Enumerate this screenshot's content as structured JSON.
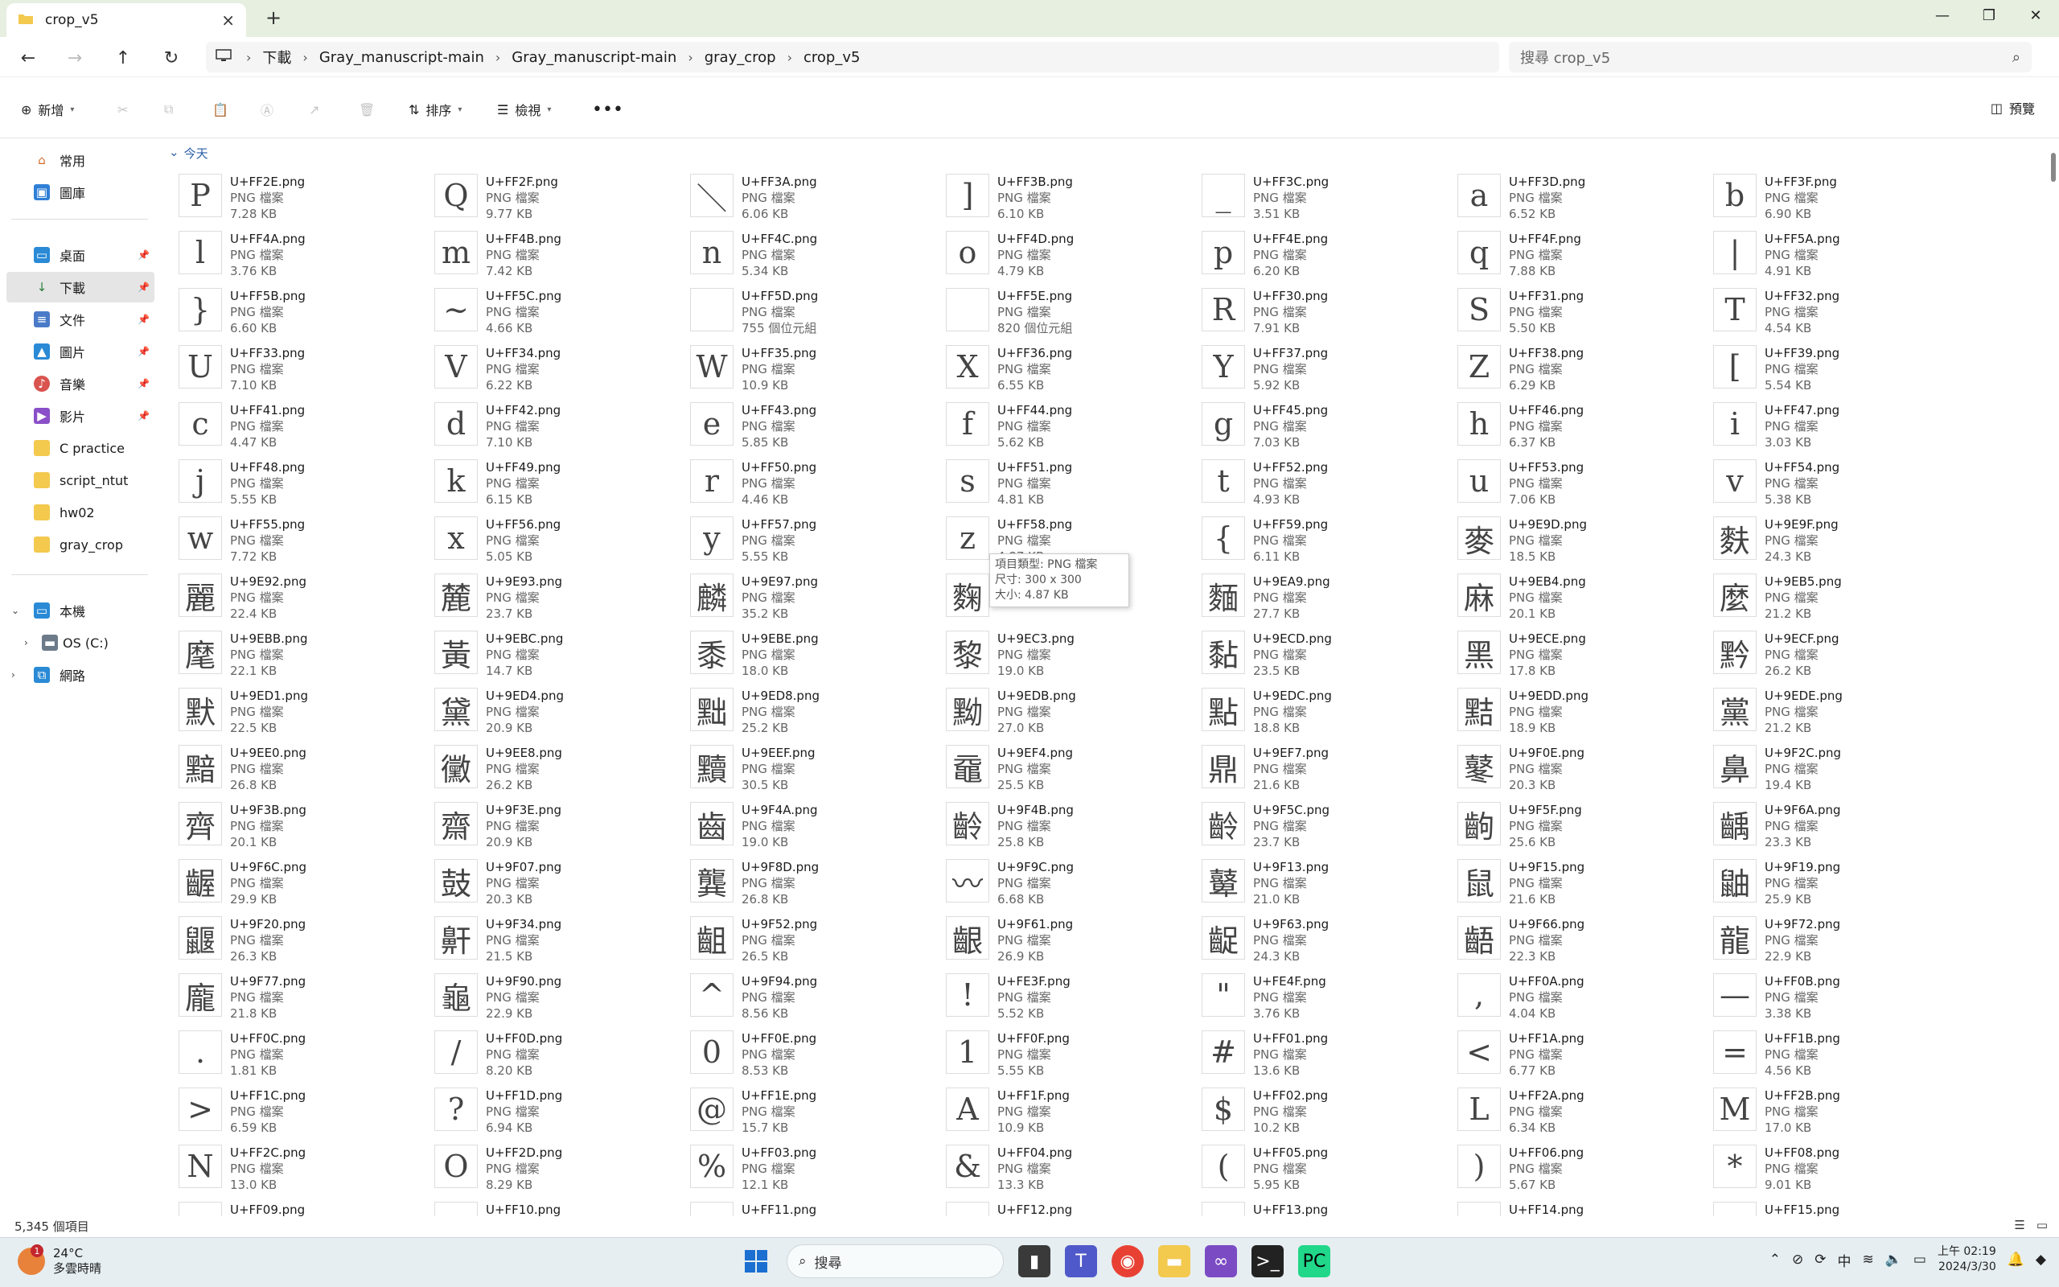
{
  "window": {
    "tab_title": "crop_v5"
  },
  "breadcrumb": [
    "下載",
    "Gray_manuscript-main",
    "Gray_manuscript-main",
    "gray_crop",
    "crop_v5"
  ],
  "search": {
    "placeholder": "搜尋 crop_v5"
  },
  "toolbar": {
    "new": "新增",
    "sort": "排序",
    "view": "檢視",
    "preview": "預覽"
  },
  "sidebar": {
    "home": "常用",
    "gallery": "圖庫",
    "pinned": [
      {
        "label": "桌面",
        "icon": "desktop-icon"
      },
      {
        "label": "下載",
        "icon": "download-icon"
      },
      {
        "label": "文件",
        "icon": "document-icon"
      },
      {
        "label": "圖片",
        "icon": "picture-icon"
      },
      {
        "label": "音樂",
        "icon": "music-icon"
      },
      {
        "label": "影片",
        "icon": "video-icon"
      }
    ],
    "folders": [
      "C practice",
      "script_ntut",
      "hw02",
      "gray_crop"
    ],
    "this_pc": "本機",
    "os_drive": "OS (C:)",
    "network": "網路"
  },
  "group_header": "今天",
  "files": [
    {
      "name": "U+FF2E.png",
      "type": "PNG 檔案",
      "size": "7.28 KB",
      "glyph": "P"
    },
    {
      "name": "U+FF2F.png",
      "type": "PNG 檔案",
      "size": "9.77 KB",
      "glyph": "Q"
    },
    {
      "name": "U+FF3A.png",
      "type": "PNG 檔案",
      "size": "6.06 KB",
      "glyph": "＼"
    },
    {
      "name": "U+FF3B.png",
      "type": "PNG 檔案",
      "size": "6.10 KB",
      "glyph": "]"
    },
    {
      "name": "U+FF3C.png",
      "type": "PNG 檔案",
      "size": "3.51 KB",
      "glyph": "_"
    },
    {
      "name": "U+FF3D.png",
      "type": "PNG 檔案",
      "size": "6.52 KB",
      "glyph": "a"
    },
    {
      "name": "U+FF3F.png",
      "type": "PNG 檔案",
      "size": "6.90 KB",
      "glyph": "b"
    },
    {
      "name": "U+FF4A.png",
      "type": "PNG 檔案",
      "size": "3.76 KB",
      "glyph": "l"
    },
    {
      "name": "U+FF4B.png",
      "type": "PNG 檔案",
      "size": "7.42 KB",
      "glyph": "m"
    },
    {
      "name": "U+FF4C.png",
      "type": "PNG 檔案",
      "size": "5.34 KB",
      "glyph": "n"
    },
    {
      "name": "U+FF4D.png",
      "type": "PNG 檔案",
      "size": "4.79 KB",
      "glyph": "o"
    },
    {
      "name": "U+FF4E.png",
      "type": "PNG 檔案",
      "size": "6.20 KB",
      "glyph": "p"
    },
    {
      "name": "U+FF4F.png",
      "type": "PNG 檔案",
      "size": "7.88 KB",
      "glyph": "q"
    },
    {
      "name": "U+FF5A.png",
      "type": "PNG 檔案",
      "size": "4.91 KB",
      "glyph": "|"
    },
    {
      "name": "U+FF5B.png",
      "type": "PNG 檔案",
      "size": "6.60 KB",
      "glyph": "}"
    },
    {
      "name": "U+FF5C.png",
      "type": "PNG 檔案",
      "size": "4.66 KB",
      "glyph": "~"
    },
    {
      "name": "U+FF5D.png",
      "type": "PNG 檔案",
      "size": "755 個位元組",
      "glyph": ""
    },
    {
      "name": "U+FF5E.png",
      "type": "PNG 檔案",
      "size": "820 個位元組",
      "glyph": ""
    },
    {
      "name": "U+FF30.png",
      "type": "PNG 檔案",
      "size": "7.91 KB",
      "glyph": "R"
    },
    {
      "name": "U+FF31.png",
      "type": "PNG 檔案",
      "size": "5.50 KB",
      "glyph": "S"
    },
    {
      "name": "U+FF32.png",
      "type": "PNG 檔案",
      "size": "4.54 KB",
      "glyph": "T"
    },
    {
      "name": "U+FF33.png",
      "type": "PNG 檔案",
      "size": "7.10 KB",
      "glyph": "U"
    },
    {
      "name": "U+FF34.png",
      "type": "PNG 檔案",
      "size": "6.22 KB",
      "glyph": "V"
    },
    {
      "name": "U+FF35.png",
      "type": "PNG 檔案",
      "size": "10.9 KB",
      "glyph": "W"
    },
    {
      "name": "U+FF36.png",
      "type": "PNG 檔案",
      "size": "6.55 KB",
      "glyph": "X"
    },
    {
      "name": "U+FF37.png",
      "type": "PNG 檔案",
      "size": "5.92 KB",
      "glyph": "Y"
    },
    {
      "name": "U+FF38.png",
      "type": "PNG 檔案",
      "size": "6.29 KB",
      "glyph": "Z"
    },
    {
      "name": "U+FF39.png",
      "type": "PNG 檔案",
      "size": "5.54 KB",
      "glyph": "["
    },
    {
      "name": "U+FF41.png",
      "type": "PNG 檔案",
      "size": "4.47 KB",
      "glyph": "c"
    },
    {
      "name": "U+FF42.png",
      "type": "PNG 檔案",
      "size": "7.10 KB",
      "glyph": "d"
    },
    {
      "name": "U+FF43.png",
      "type": "PNG 檔案",
      "size": "5.85 KB",
      "glyph": "e"
    },
    {
      "name": "U+FF44.png",
      "type": "PNG 檔案",
      "size": "5.62 KB",
      "glyph": "f"
    },
    {
      "name": "U+FF45.png",
      "type": "PNG 檔案",
      "size": "7.03 KB",
      "glyph": "g"
    },
    {
      "name": "U+FF46.png",
      "type": "PNG 檔案",
      "size": "6.37 KB",
      "glyph": "h"
    },
    {
      "name": "U+FF47.png",
      "type": "PNG 檔案",
      "size": "3.03 KB",
      "glyph": "i"
    },
    {
      "name": "U+FF48.png",
      "type": "PNG 檔案",
      "size": "5.55 KB",
      "glyph": "j"
    },
    {
      "name": "U+FF49.png",
      "type": "PNG 檔案",
      "size": "6.15 KB",
      "glyph": "k"
    },
    {
      "name": "U+FF50.png",
      "type": "PNG 檔案",
      "size": "4.46 KB",
      "glyph": "r"
    },
    {
      "name": "U+FF51.png",
      "type": "PNG 檔案",
      "size": "4.81 KB",
      "glyph": "s"
    },
    {
      "name": "U+FF52.png",
      "type": "PNG 檔案",
      "size": "4.93 KB",
      "glyph": "t"
    },
    {
      "name": "U+FF53.png",
      "type": "PNG 檔案",
      "size": "7.06 KB",
      "glyph": "u"
    },
    {
      "name": "U+FF54.png",
      "type": "PNG 檔案",
      "size": "5.38 KB",
      "glyph": "v"
    },
    {
      "name": "U+FF55.png",
      "type": "PNG 檔案",
      "size": "7.72 KB",
      "glyph": "w"
    },
    {
      "name": "U+FF56.png",
      "type": "PNG 檔案",
      "size": "5.05 KB",
      "glyph": "x"
    },
    {
      "name": "U+FF57.png",
      "type": "PNG 檔案",
      "size": "5.55 KB",
      "glyph": "y"
    },
    {
      "name": "U+FF58.png",
      "type": "PNG 檔案",
      "size": "4.87 KB",
      "glyph": "z"
    },
    {
      "name": "U+FF59.png",
      "type": "PNG 檔案",
      "size": "6.11 KB",
      "glyph": "{"
    },
    {
      "name": "U+9E9D.png",
      "type": "PNG 檔案",
      "size": "18.5 KB",
      "glyph": "麥"
    },
    {
      "name": "U+9E9F.png",
      "type": "PNG 檔案",
      "size": "24.3 KB",
      "glyph": "麩"
    },
    {
      "name": "U+9E92.png",
      "type": "PNG 檔案",
      "size": "22.4 KB",
      "glyph": "麗"
    },
    {
      "name": "U+9E93.png",
      "type": "PNG 檔案",
      "size": "23.7 KB",
      "glyph": "麓"
    },
    {
      "name": "U+9E97.png",
      "type": "PNG 檔案",
      "size": "35.2 KB",
      "glyph": "麟"
    },
    {
      "name": "",
      "type": "",
      "size": "25.6 KB",
      "glyph": "麴"
    },
    {
      "name": "U+9EA9.png",
      "type": "PNG 檔案",
      "size": "27.7 KB",
      "glyph": "麵"
    },
    {
      "name": "U+9EB4.png",
      "type": "PNG 檔案",
      "size": "20.1 KB",
      "glyph": "麻"
    },
    {
      "name": "U+9EB5.png",
      "type": "PNG 檔案",
      "size": "21.2 KB",
      "glyph": "麼"
    },
    {
      "name": "U+9EBB.png",
      "type": "PNG 檔案",
      "size": "22.1 KB",
      "glyph": "麾"
    },
    {
      "name": "U+9EBC.png",
      "type": "PNG 檔案",
      "size": "14.7 KB",
      "glyph": "黃"
    },
    {
      "name": "U+9EBE.png",
      "type": "PNG 檔案",
      "size": "18.0 KB",
      "glyph": "黍"
    },
    {
      "name": "U+9EC3.png",
      "type": "PNG 檔案",
      "size": "19.0 KB",
      "glyph": "黎"
    },
    {
      "name": "U+9ECD.png",
      "type": "PNG 檔案",
      "size": "23.5 KB",
      "glyph": "黏"
    },
    {
      "name": "U+9ECE.png",
      "type": "PNG 檔案",
      "size": "17.8 KB",
      "glyph": "黑"
    },
    {
      "name": "U+9ECF.png",
      "type": "PNG 檔案",
      "size": "26.2 KB",
      "glyph": "黔"
    },
    {
      "name": "U+9ED1.png",
      "type": "PNG 檔案",
      "size": "22.5 KB",
      "glyph": "默"
    },
    {
      "name": "U+9ED4.png",
      "type": "PNG 檔案",
      "size": "20.9 KB",
      "glyph": "黛"
    },
    {
      "name": "U+9ED8.png",
      "type": "PNG 檔案",
      "size": "25.2 KB",
      "glyph": "黜"
    },
    {
      "name": "U+9EDB.png",
      "type": "PNG 檔案",
      "size": "27.0 KB",
      "glyph": "黝"
    },
    {
      "name": "U+9EDC.png",
      "type": "PNG 檔案",
      "size": "18.8 KB",
      "glyph": "點"
    },
    {
      "name": "U+9EDD.png",
      "type": "PNG 檔案",
      "size": "18.9 KB",
      "glyph": "黠"
    },
    {
      "name": "U+9EDE.png",
      "type": "PNG 檔案",
      "size": "21.2 KB",
      "glyph": "黨"
    },
    {
      "name": "U+9EE0.png",
      "type": "PNG 檔案",
      "size": "26.8 KB",
      "glyph": "黯"
    },
    {
      "name": "U+9EE8.png",
      "type": "PNG 檔案",
      "size": "26.2 KB",
      "glyph": "黴"
    },
    {
      "name": "U+9EEF.png",
      "type": "PNG 檔案",
      "size": "30.5 KB",
      "glyph": "黷"
    },
    {
      "name": "U+9EF4.png",
      "type": "PNG 檔案",
      "size": "25.5 KB",
      "glyph": "黿"
    },
    {
      "name": "U+9EF7.png",
      "type": "PNG 檔案",
      "size": "21.6 KB",
      "glyph": "鼎"
    },
    {
      "name": "U+9F0E.png",
      "type": "PNG 檔案",
      "size": "20.3 KB",
      "glyph": "鼕"
    },
    {
      "name": "U+9F2C.png",
      "type": "PNG 檔案",
      "size": "19.4 KB",
      "glyph": "鼻"
    },
    {
      "name": "U+9F3B.png",
      "type": "PNG 檔案",
      "size": "20.1 KB",
      "glyph": "齊"
    },
    {
      "name": "U+9F3E.png",
      "type": "PNG 檔案",
      "size": "20.9 KB",
      "glyph": "齋"
    },
    {
      "name": "U+9F4A.png",
      "type": "PNG 檔案",
      "size": "19.0 KB",
      "glyph": "齒"
    },
    {
      "name": "U+9F4B.png",
      "type": "PNG 檔案",
      "size": "25.8 KB",
      "glyph": "齡"
    },
    {
      "name": "U+9F5C.png",
      "type": "PNG 檔案",
      "size": "23.7 KB",
      "glyph": "齡"
    },
    {
      "name": "U+9F5F.png",
      "type": "PNG 檔案",
      "size": "25.6 KB",
      "glyph": "齣"
    },
    {
      "name": "U+9F6A.png",
      "type": "PNG 檔案",
      "size": "23.3 KB",
      "glyph": "齲"
    },
    {
      "name": "U+9F6C.png",
      "type": "PNG 檔案",
      "size": "29.9 KB",
      "glyph": "齷"
    },
    {
      "name": "U+9F07.png",
      "type": "PNG 檔案",
      "size": "20.3 KB",
      "glyph": "鼓"
    },
    {
      "name": "U+9F8D.png",
      "type": "PNG 檔案",
      "size": "26.8 KB",
      "glyph": "龔"
    },
    {
      "name": "U+9F9C.png",
      "type": "PNG 檔案",
      "size": "6.68 KB",
      "glyph": "〰"
    },
    {
      "name": "U+9F13.png",
      "type": "PNG 檔案",
      "size": "21.0 KB",
      "glyph": "鼙"
    },
    {
      "name": "U+9F15.png",
      "type": "PNG 檔案",
      "size": "21.6 KB",
      "glyph": "鼠"
    },
    {
      "name": "U+9F19.png",
      "type": "PNG 檔案",
      "size": "25.9 KB",
      "glyph": "鼬"
    },
    {
      "name": "U+9F20.png",
      "type": "PNG 檔案",
      "size": "26.3 KB",
      "glyph": "鼴"
    },
    {
      "name": "U+9F34.png",
      "type": "PNG 檔案",
      "size": "21.5 KB",
      "glyph": "鼾"
    },
    {
      "name": "U+9F52.png",
      "type": "PNG 檔案",
      "size": "26.5 KB",
      "glyph": "齟"
    },
    {
      "name": "U+9F61.png",
      "type": "PNG 檔案",
      "size": "26.9 KB",
      "glyph": "齦"
    },
    {
      "name": "U+9F63.png",
      "type": "PNG 檔案",
      "size": "24.3 KB",
      "glyph": "齪"
    },
    {
      "name": "U+9F66.png",
      "type": "PNG 檔案",
      "size": "22.3 KB",
      "glyph": "齬"
    },
    {
      "name": "U+9F72.png",
      "type": "PNG 檔案",
      "size": "22.9 KB",
      "glyph": "龍"
    },
    {
      "name": "U+9F77.png",
      "type": "PNG 檔案",
      "size": "21.8 KB",
      "glyph": "龐"
    },
    {
      "name": "U+9F90.png",
      "type": "PNG 檔案",
      "size": "22.9 KB",
      "glyph": "龜"
    },
    {
      "name": "U+9F94.png",
      "type": "PNG 檔案",
      "size": "8.56 KB",
      "glyph": "^"
    },
    {
      "name": "U+FE3F.png",
      "type": "PNG 檔案",
      "size": "5.52 KB",
      "glyph": "!"
    },
    {
      "name": "U+FE4F.png",
      "type": "PNG 檔案",
      "size": "3.76 KB",
      "glyph": "\""
    },
    {
      "name": "U+FF0A.png",
      "type": "PNG 檔案",
      "size": "4.04 KB",
      "glyph": ","
    },
    {
      "name": "U+FF0B.png",
      "type": "PNG 檔案",
      "size": "3.38 KB",
      "glyph": "—"
    },
    {
      "name": "U+FF0C.png",
      "type": "PNG 檔案",
      "size": "1.81 KB",
      "glyph": "."
    },
    {
      "name": "U+FF0D.png",
      "type": "PNG 檔案",
      "size": "8.20 KB",
      "glyph": "/"
    },
    {
      "name": "U+FF0E.png",
      "type": "PNG 檔案",
      "size": "8.53 KB",
      "glyph": "0"
    },
    {
      "name": "U+FF0F.png",
      "type": "PNG 檔案",
      "size": "5.55 KB",
      "glyph": "1"
    },
    {
      "name": "U+FF01.png",
      "type": "PNG 檔案",
      "size": "13.6 KB",
      "glyph": "#"
    },
    {
      "name": "U+FF1A.png",
      "type": "PNG 檔案",
      "size": "6.77 KB",
      "glyph": "<"
    },
    {
      "name": "U+FF1B.png",
      "type": "PNG 檔案",
      "size": "4.56 KB",
      "glyph": "="
    },
    {
      "name": "U+FF1C.png",
      "type": "PNG 檔案",
      "size": "6.59 KB",
      "glyph": ">"
    },
    {
      "name": "U+FF1D.png",
      "type": "PNG 檔案",
      "size": "6.94 KB",
      "glyph": "?"
    },
    {
      "name": "U+FF1E.png",
      "type": "PNG 檔案",
      "size": "15.7 KB",
      "glyph": "@"
    },
    {
      "name": "U+FF1F.png",
      "type": "PNG 檔案",
      "size": "10.9 KB",
      "glyph": "A"
    },
    {
      "name": "U+FF02.png",
      "type": "PNG 檔案",
      "size": "10.2 KB",
      "glyph": "$"
    },
    {
      "name": "U+FF2A.png",
      "type": "PNG 檔案",
      "size": "6.34 KB",
      "glyph": "L"
    },
    {
      "name": "U+FF2B.png",
      "type": "PNG 檔案",
      "size": "17.0 KB",
      "glyph": "M"
    },
    {
      "name": "U+FF2C.png",
      "type": "PNG 檔案",
      "size": "13.0 KB",
      "glyph": "N"
    },
    {
      "name": "U+FF2D.png",
      "type": "PNG 檔案",
      "size": "8.29 KB",
      "glyph": "O"
    },
    {
      "name": "U+FF03.png",
      "type": "PNG 檔案",
      "size": "12.1 KB",
      "glyph": "%"
    },
    {
      "name": "U+FF04.png",
      "type": "PNG 檔案",
      "size": "13.3 KB",
      "glyph": "&"
    },
    {
      "name": "U+FF05.png",
      "type": "PNG 檔案",
      "size": "5.95 KB",
      "glyph": "("
    },
    {
      "name": "U+FF06.png",
      "type": "PNG 檔案",
      "size": "5.67 KB",
      "glyph": ")"
    },
    {
      "name": "U+FF08.png",
      "type": "PNG 檔案",
      "size": "9.01 KB",
      "glyph": "*"
    },
    {
      "name": "U+FF09.png",
      "type": "",
      "size": "",
      "glyph": ""
    },
    {
      "name": "U+FF10.png",
      "type": "",
      "size": "",
      "glyph": ""
    },
    {
      "name": "U+FF11.png",
      "type": "",
      "size": "",
      "glyph": ""
    },
    {
      "name": "U+FF12.png",
      "type": "",
      "size": "",
      "glyph": ""
    },
    {
      "name": "U+FF13.png",
      "type": "",
      "size": "",
      "glyph": ""
    },
    {
      "name": "U+FF14.png",
      "type": "",
      "size": "",
      "glyph": ""
    },
    {
      "name": "U+FF15.png",
      "type": "",
      "size": "",
      "glyph": ""
    }
  ],
  "tooltip": {
    "line1": "項目類型: PNG 檔案",
    "line2": "尺寸: 300 x 300",
    "line3": "大小: 4.87 KB"
  },
  "status": {
    "count": "5,345 個項目"
  },
  "taskbar": {
    "temp": "24°C",
    "weather": "多雲時晴",
    "badge": "1",
    "search": "搜尋",
    "ime": "中",
    "time": "上午 02:19",
    "date": "2024/3/30"
  }
}
